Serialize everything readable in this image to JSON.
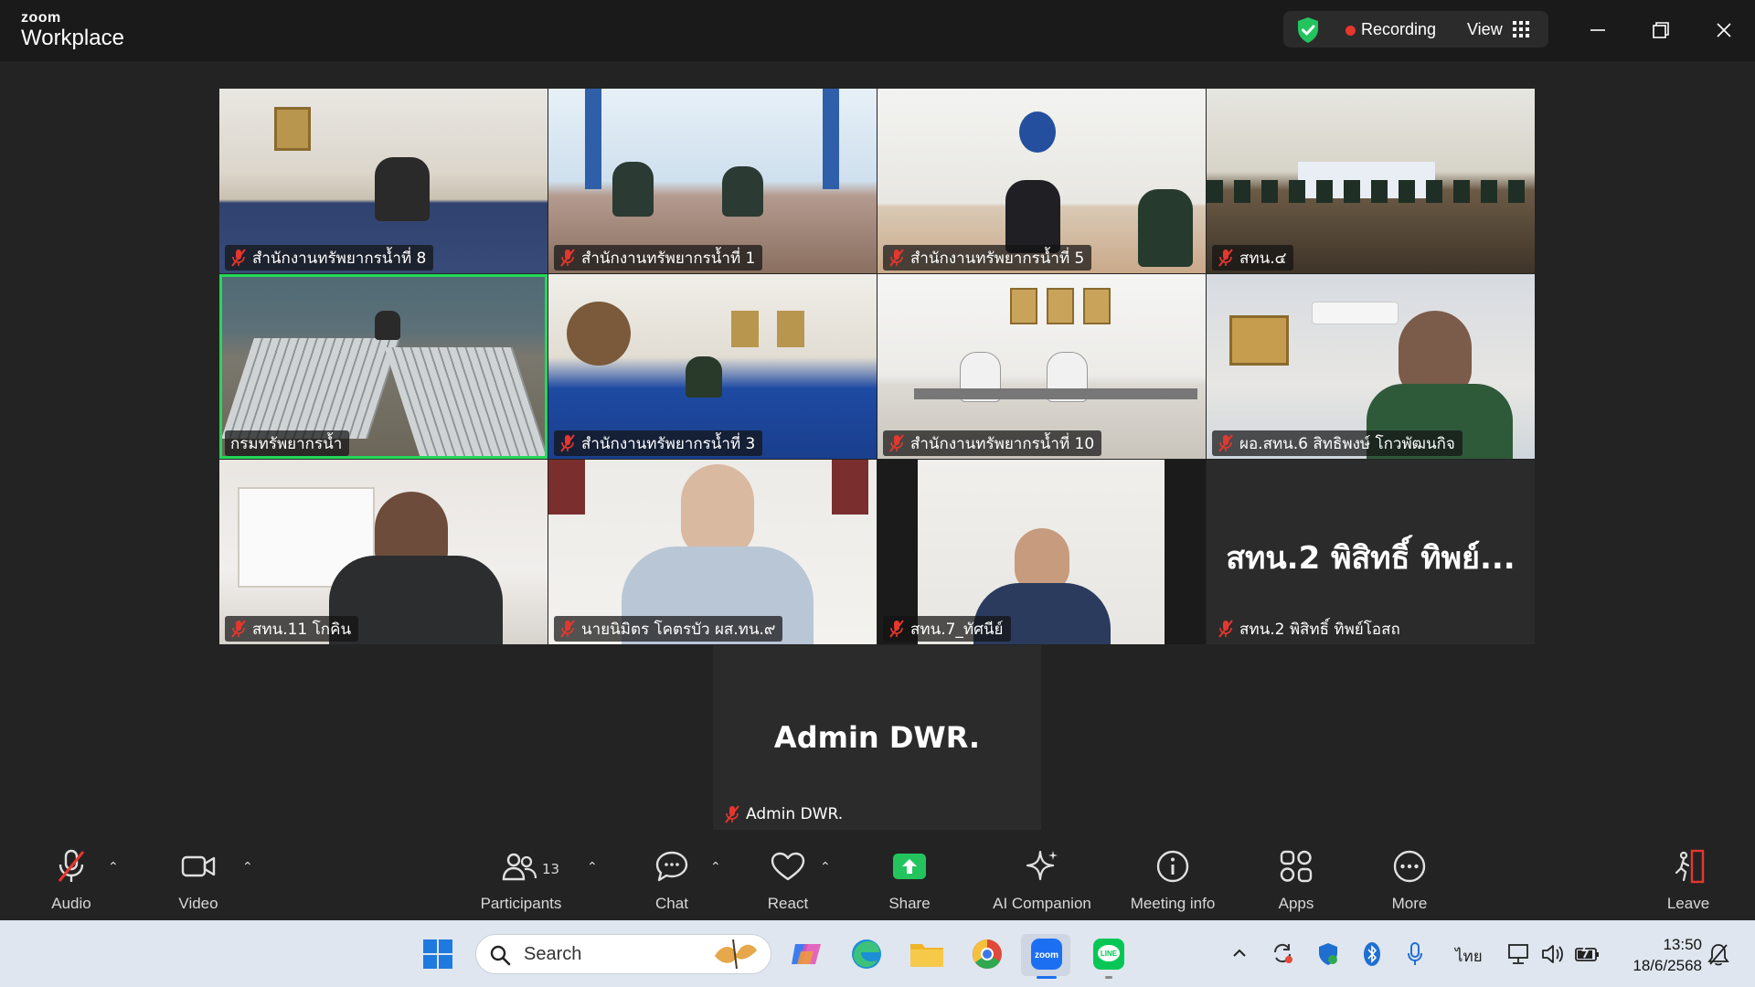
{
  "titlebar": {
    "logo_top": "zoom",
    "logo_bottom": "Workplace",
    "recording_label": "Recording",
    "view_label": "View",
    "colors": {
      "recording_dot": "#e5372d",
      "shield": "#23c45e"
    }
  },
  "gallery": {
    "tiles": [
      {
        "label": "สำนักงานทรัพยากรน้ำที่ 8"
      },
      {
        "label": "สำนักงานทรัพยากรน้ำที่ 1"
      },
      {
        "label": "สำนักงานทรัพยากรน้ำที่ 5"
      },
      {
        "label": "สทน.๔"
      },
      {
        "label": "กรมทรัพยากรน้ำ"
      },
      {
        "label": "สำนักงานทรัพยากรน้ำที่ 3"
      },
      {
        "label": "สำนักงานทรัพยากรน้ำที่ 10"
      },
      {
        "label": "ผอ.สทน.6 สิทธิพงษ์ โกวพัฒนกิจ"
      },
      {
        "label": "สทน.11 โกคิน"
      },
      {
        "label": "นายนิมิตร โคตรบัว ผส.ทน.๙"
      },
      {
        "label": "สทน.7_ทัศนีย์"
      },
      {
        "label": "สทน.2 พิสิทธิ์ ทิพย์โอสถ",
        "big_name": "สทน.2 พิสิทธิ์ ทิพย์..."
      },
      {
        "label": "Admin DWR.",
        "big_name": "Admin DWR."
      }
    ],
    "active_speaker_color": "#23d959"
  },
  "toolbar": {
    "audio": "Audio",
    "video": "Video",
    "participants": "Participants",
    "participants_count": "13",
    "chat": "Chat",
    "react": "React",
    "share": "Share",
    "ai_companion": "AI Companion",
    "meeting_info": "Meeting info",
    "apps": "Apps",
    "more": "More",
    "leave": "Leave",
    "colors": {
      "share": "#23c45e",
      "muted": "#e5372d"
    }
  },
  "taskbar": {
    "search_placeholder": "Search",
    "language": "ไทย",
    "time": "13:50",
    "date": "18/6/2568"
  }
}
